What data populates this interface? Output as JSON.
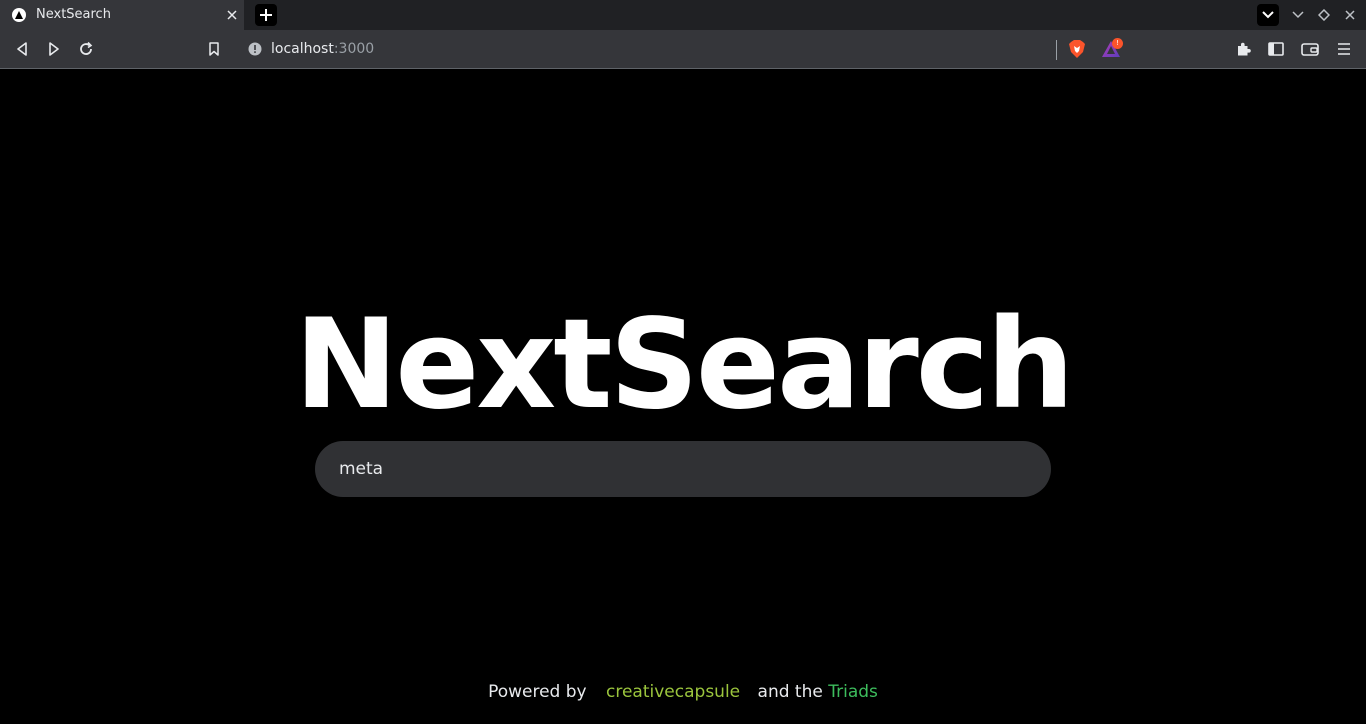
{
  "browser": {
    "tab": {
      "title": "NextSearch"
    },
    "url": {
      "host": "localhost",
      "port": ":3000"
    },
    "rewards_badge": "!",
    "colors": {
      "brave_orange": "#fb542b",
      "chrome_bg": "#35363a",
      "tabbar_bg": "#202124"
    }
  },
  "page": {
    "title": "NextSearch",
    "search": {
      "value": "meta",
      "placeholder": ""
    },
    "footer": {
      "powered_by": "Powered by",
      "brand_one": "creativecapsule",
      "and_the": "and the",
      "brand_two": "Triads"
    },
    "colors": {
      "background": "#000000",
      "search_bg": "#303134",
      "brand_one": "#9bc53d",
      "brand_two": "#3dbd5d"
    }
  }
}
